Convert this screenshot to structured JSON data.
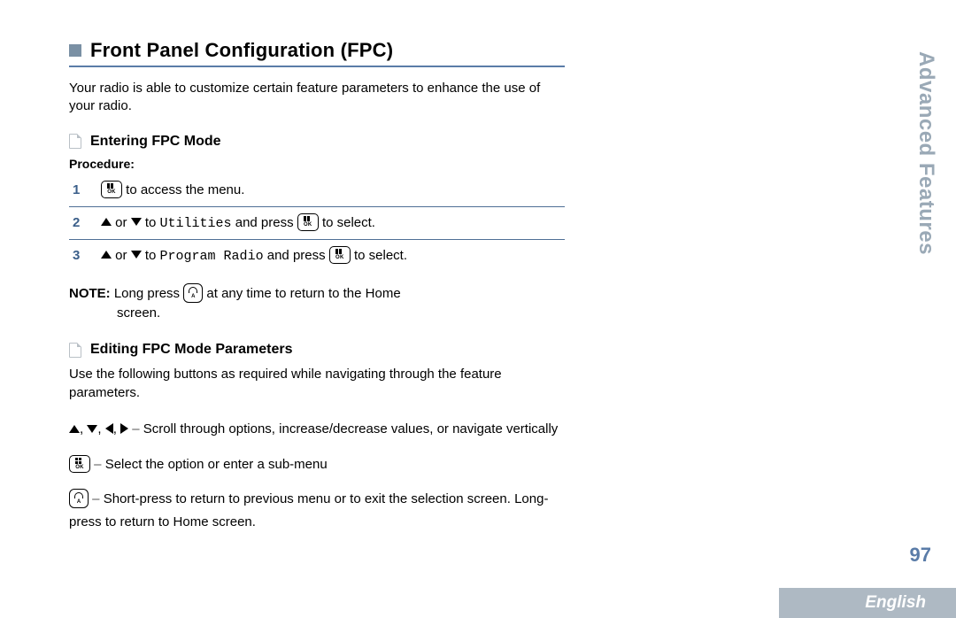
{
  "title": "Front Panel Configuration (FPC)",
  "intro": "Your radio is able to customize certain feature parameters to enhance the use of your radio.",
  "section1": {
    "title": "Entering FPC Mode",
    "procedure_label": "Procedure:",
    "steps": [
      {
        "n": "1",
        "after_key": " to access the menu."
      },
      {
        "n": "2",
        "pre": " or ",
        "mid": " to ",
        "target": "Utilities",
        "press": " and press ",
        "tail": " to select."
      },
      {
        "n": "3",
        "pre": " or ",
        "mid": " to ",
        "target": "Program Radio",
        "press": " and press ",
        "tail": " to select."
      }
    ],
    "note_label": "NOTE:",
    "note_a": "  Long press ",
    "note_b": " at any time to return to the Home",
    "note_c": "screen."
  },
  "section2": {
    "title": "Editing FPC Mode Parameters",
    "intro": "Use the following buttons as required while navigating through the feature parameters.",
    "row1_tail": " Scroll through options, increase/decrease values, or navigate vertically",
    "row2_tail": " Select the option or enter a sub-menu",
    "row3_tail": " Short-press to return to previous menu or to exit the selection screen. Long-press to return to Home screen."
  },
  "comma": ", ",
  "dash": " – ",
  "key_ok_label": "OK",
  "key_back_label": "A",
  "side_tab": "Advanced Features",
  "page_number": "97",
  "language": "English"
}
